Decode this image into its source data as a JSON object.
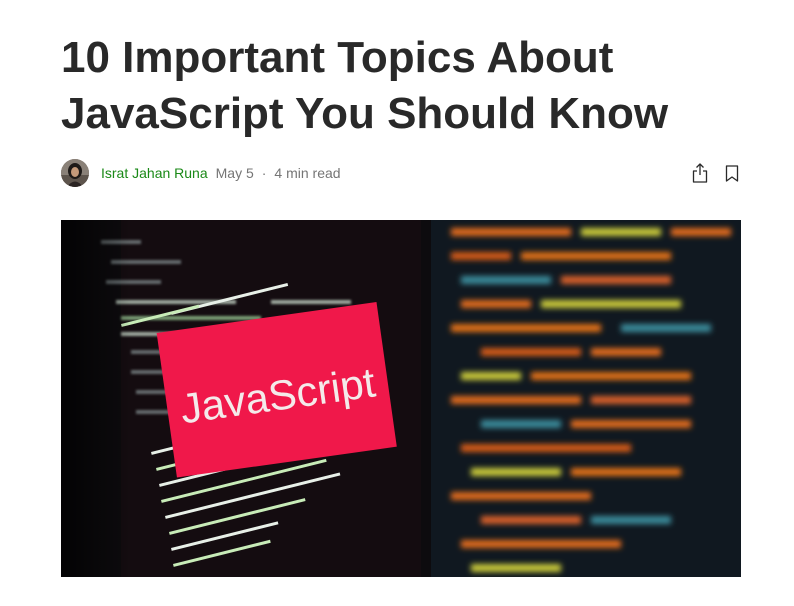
{
  "article": {
    "title": "10 Important Topics About JavaScript You Should Know",
    "author": "Israt Jahan Runa",
    "date": "May 5",
    "separator": "·",
    "read_time": "4 min read"
  },
  "actions": {
    "share_icon": "share-icon",
    "bookmark_icon": "bookmark-icon"
  },
  "hero_image": {
    "sign_text": "JavaScript",
    "sign_color": "#f0184a"
  },
  "colors": {
    "title": "#292929",
    "author": "#1a8917",
    "meta": "#757575"
  }
}
